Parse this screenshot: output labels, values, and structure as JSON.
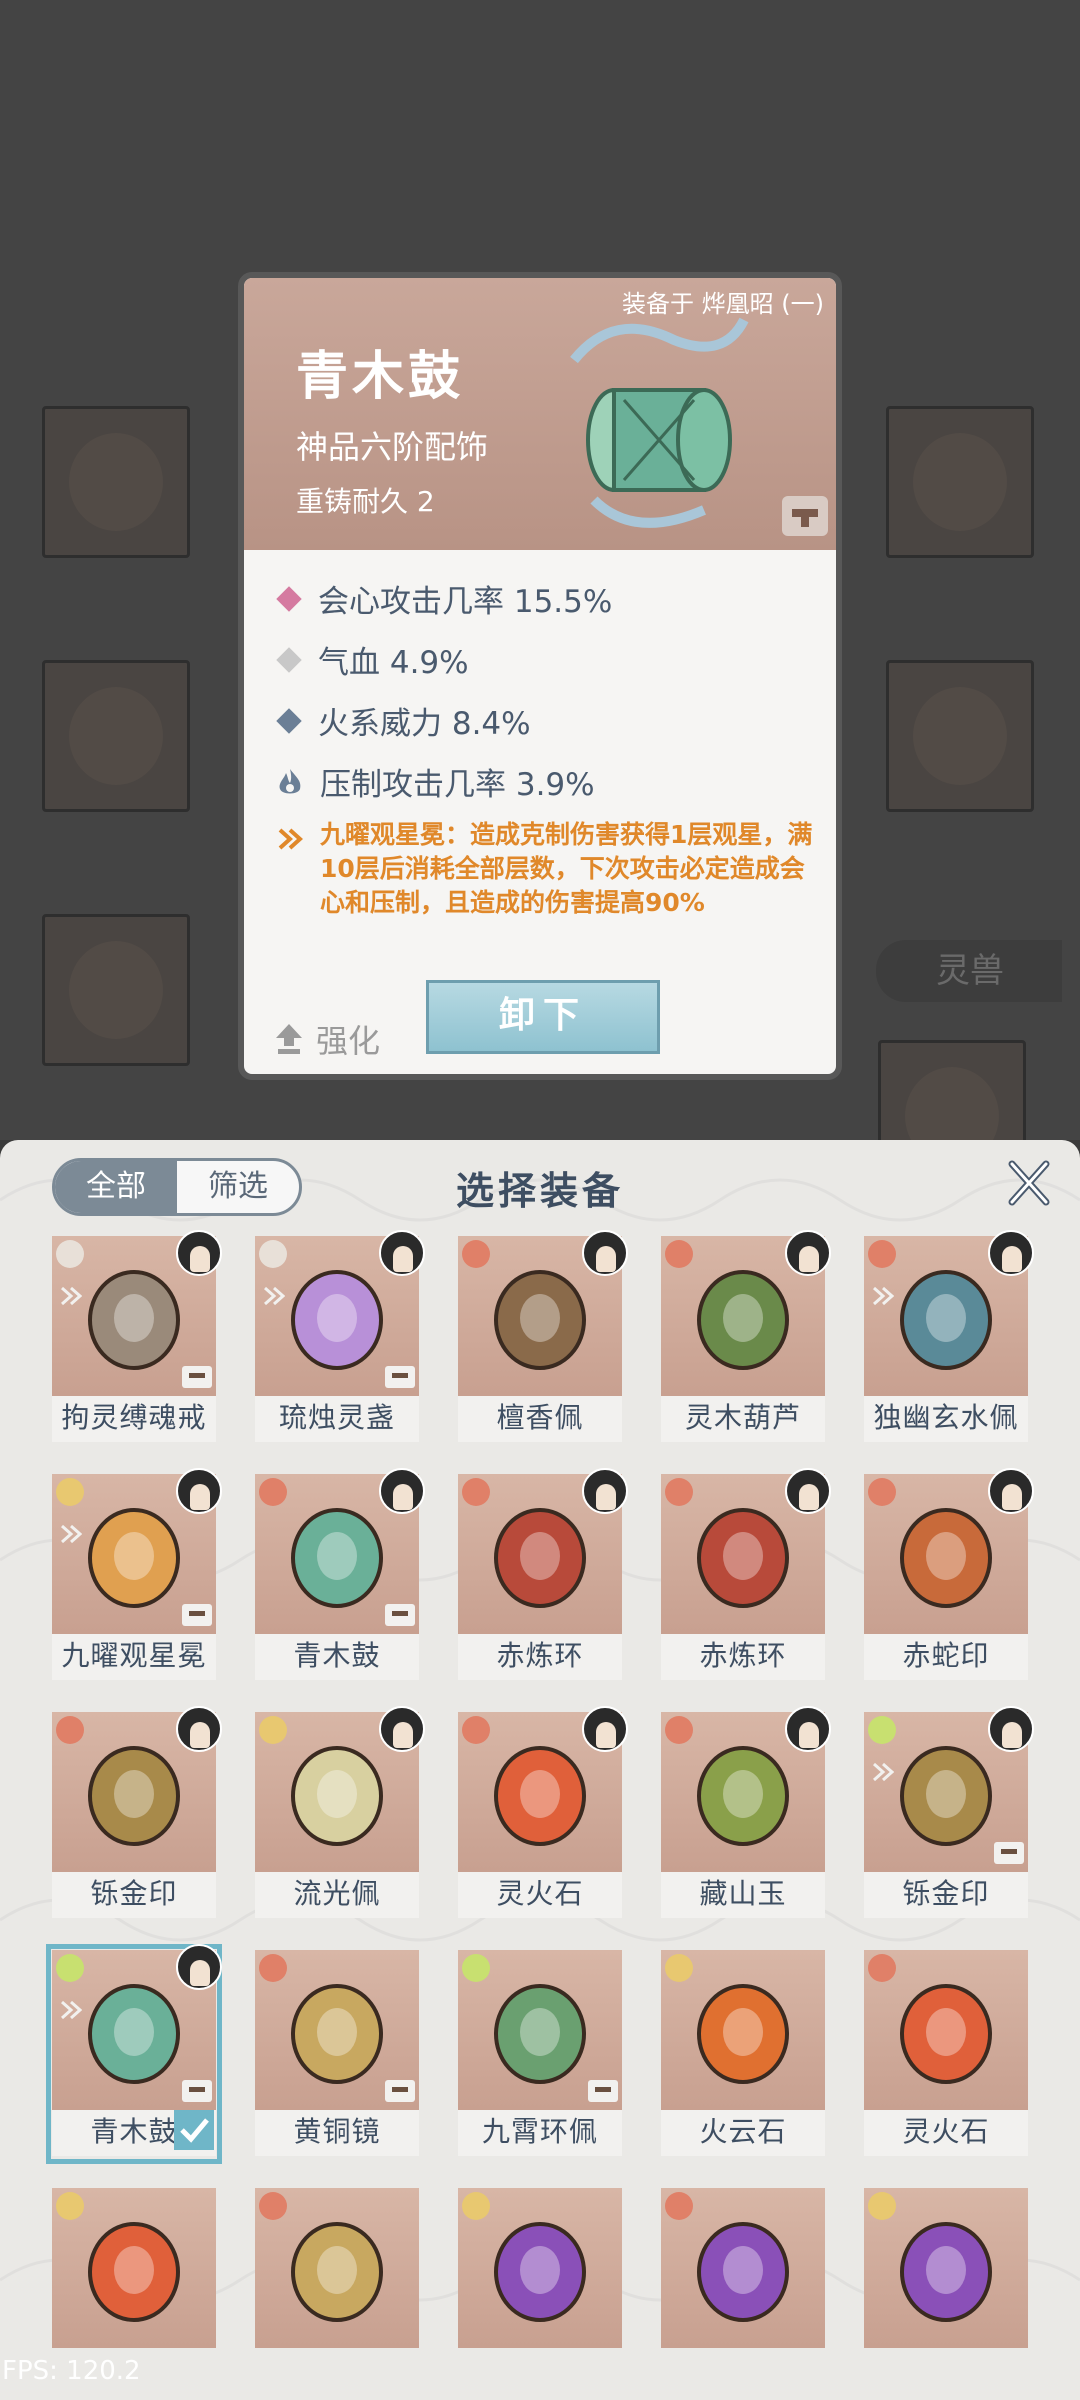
{
  "background": {
    "tab_label": "灵兽"
  },
  "detail": {
    "equipped_to": "装备于 烨凰昭 (一)",
    "name": "青木鼓",
    "grade": "神品六阶配饰",
    "durability": "重铸耐久 2",
    "stats": [
      {
        "text": "会心攻击几率 15.5%",
        "color": "#d57aa0"
      },
      {
        "text": "气血 4.9%",
        "color": "#c8c8c8"
      },
      {
        "text": "火系威力 8.4%",
        "color": "#6b7f96"
      },
      {
        "text": "压制攻击几率 3.9%",
        "color": "#6b7f96"
      }
    ],
    "set_effect": "九曜观星冕：造成克制伤害获得1层观星，满10层后消耗全部层数，下次攻击必定造成会心和压制，且造成的伤害提高90%",
    "upgrade_label": "强化",
    "unequip_label": "卸下"
  },
  "panel": {
    "filter_all": "全部",
    "filter_screen": "筛选",
    "title": "选择装备",
    "items": [
      {
        "name": "拘灵缚魂戒",
        "elem": "#e8e0d8",
        "art": "#9a8a7a",
        "avatar": true,
        "set": true,
        "lock": true
      },
      {
        "name": "琉烛灵盏",
        "elem": "#e8e0d8",
        "art": "#b890d8",
        "avatar": true,
        "set": true,
        "lock": true
      },
      {
        "name": "檀香佩",
        "elem": "#e08068",
        "art": "#8a6a4a",
        "avatar": true,
        "set": false,
        "lock": false
      },
      {
        "name": "灵木葫芦",
        "elem": "#e08068",
        "art": "#6a8a4a",
        "avatar": true,
        "set": false,
        "lock": false
      },
      {
        "name": "独幽玄水佩",
        "elem": "#e08068",
        "art": "#5a8a98",
        "avatar": true,
        "set": true,
        "lock": false
      },
      {
        "name": "九曜观星冕",
        "elem": "#e8c870",
        "art": "#e0a050",
        "avatar": true,
        "set": true,
        "lock": true
      },
      {
        "name": "青木鼓",
        "elem": "#e08068",
        "art": "#6ab098",
        "avatar": true,
        "set": false,
        "lock": true
      },
      {
        "name": "赤炼环",
        "elem": "#e08068",
        "art": "#b84a3a",
        "avatar": true,
        "set": false,
        "lock": false
      },
      {
        "name": "赤炼环",
        "elem": "#e08068",
        "art": "#b84a3a",
        "avatar": true,
        "set": false,
        "lock": false
      },
      {
        "name": "赤蛇印",
        "elem": "#e08068",
        "art": "#c86a3a",
        "avatar": true,
        "set": false,
        "lock": false
      },
      {
        "name": "铄金印",
        "elem": "#e08068",
        "art": "#a88a4a",
        "avatar": true,
        "set": false,
        "lock": false
      },
      {
        "name": "流光佩",
        "elem": "#e8c870",
        "art": "#d8d0a0",
        "avatar": true,
        "set": false,
        "lock": false
      },
      {
        "name": "灵火石",
        "elem": "#e08068",
        "art": "#e0603a",
        "avatar": true,
        "set": false,
        "lock": false
      },
      {
        "name": "藏山玉",
        "elem": "#e08068",
        "art": "#8aa04a",
        "avatar": true,
        "set": false,
        "lock": false
      },
      {
        "name": "铄金印",
        "elem": "#c8e070",
        "art": "#a88a4a",
        "avatar": true,
        "set": true,
        "lock": true
      },
      {
        "name": "青木鼓",
        "elem": "#c8e070",
        "art": "#6ab098",
        "avatar": true,
        "set": true,
        "lock": true,
        "selected": true
      },
      {
        "name": "黄铜镜",
        "elem": "#e08068",
        "art": "#c8a860",
        "avatar": false,
        "set": false,
        "lock": true
      },
      {
        "name": "九霄环佩",
        "elem": "#c8e070",
        "art": "#6aa070",
        "avatar": false,
        "set": false,
        "lock": true
      },
      {
        "name": "火云石",
        "elem": "#e8c870",
        "art": "#e07030",
        "avatar": false,
        "set": false,
        "lock": false
      },
      {
        "name": "灵火石",
        "elem": "#e08068",
        "art": "#e0603a",
        "avatar": false,
        "set": false,
        "lock": false
      },
      {
        "name": "",
        "elem": "#e8c870",
        "art": "#e0603a",
        "avatar": false,
        "set": false,
        "lock": false
      },
      {
        "name": "",
        "elem": "#e08068",
        "art": "#c8a860",
        "avatar": false,
        "set": false,
        "lock": false
      },
      {
        "name": "",
        "elem": "#e8c870",
        "art": "#8a50b8",
        "avatar": false,
        "set": false,
        "lock": false
      },
      {
        "name": "",
        "elem": "#e08068",
        "art": "#8a50b8",
        "avatar": false,
        "set": false,
        "lock": false
      },
      {
        "name": "",
        "elem": "#e8c870",
        "art": "#8a50b8",
        "avatar": false,
        "set": false,
        "lock": false
      }
    ]
  },
  "fps": "FPS: 120.2"
}
